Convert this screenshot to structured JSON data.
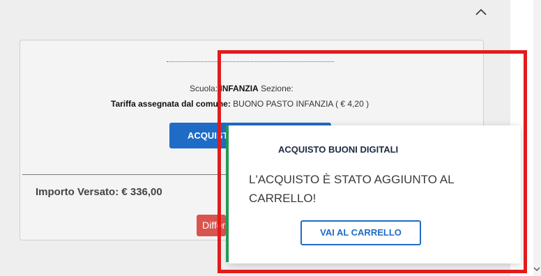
{
  "card": {
    "scuola_label": "Scuola:",
    "scuola_value": "INFANZIA",
    "sezione_label": "Sezione:",
    "tariffa_label": "Tariffa assegnata dal comune:",
    "tariffa_value": "BUONO PASTO INFANZIA ( € 4,20 )",
    "acquista_button": "ACQUISTA BUONI",
    "importo": "Importo Versato: € 336,00",
    "differenza_button": "Differenza"
  },
  "popup": {
    "title": "ACQUISTO BUONI DIGITALI",
    "message": "L'ACQUISTO È STATO AGGIUNTO AL CARRELLO!",
    "cart_button": "VAI AL CARRELLO"
  },
  "colors": {
    "primary": "#1f6cc6",
    "danger": "#d9534f",
    "success": "#27a35a",
    "highlight": "#e31b1b"
  },
  "icons": {
    "collapse": "chevron-up-icon",
    "scroll": "chevron-down-icon"
  }
}
